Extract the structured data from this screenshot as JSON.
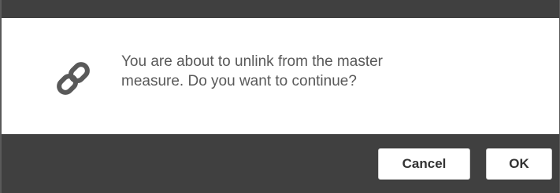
{
  "dialog": {
    "message_line1": "You are about to unlink from the master",
    "message_line2": "measure. Do you want to continue?",
    "icon": "link-icon"
  },
  "buttons": {
    "cancel_label": "Cancel",
    "ok_label": "OK"
  },
  "colors": {
    "chrome": "#404040",
    "body_background": "#ffffff",
    "icon": "#595959",
    "text": "#595959"
  }
}
